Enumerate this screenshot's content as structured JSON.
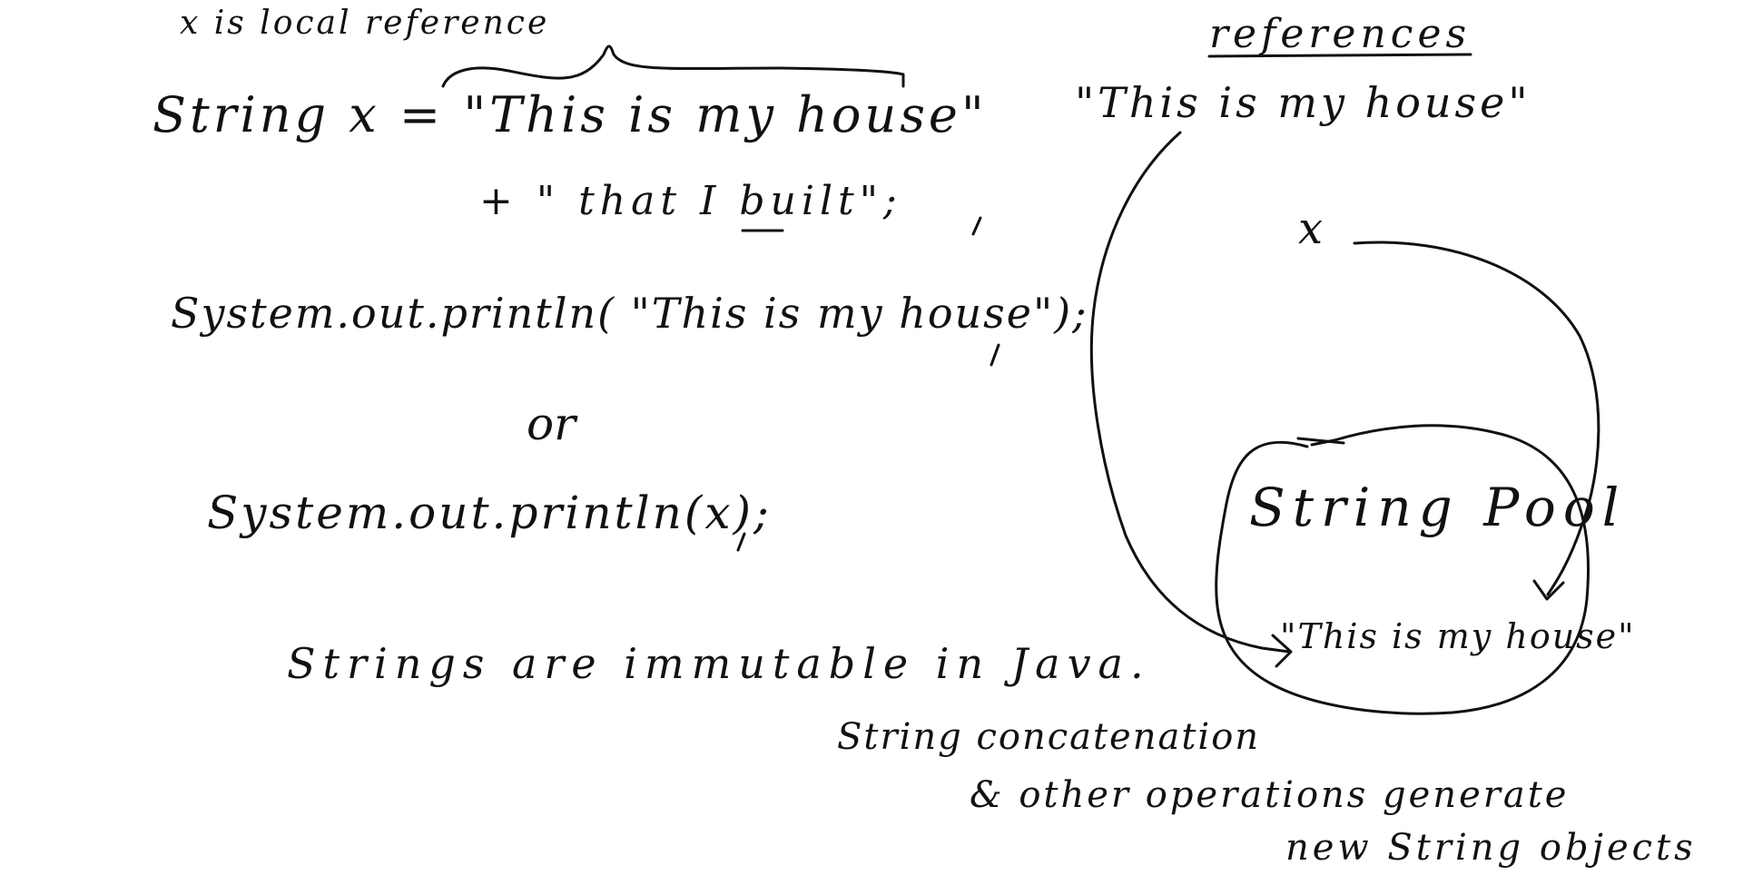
{
  "left": {
    "local_note": "x is local reference",
    "code_line1": "String x = \"This is my house\"",
    "code_line2": "+ \" that I built\";",
    "println_literal": "System.out.println( \"This is my house\");",
    "or": "or",
    "println_var": "System.out.println(x);",
    "immutable": "Strings are immutable in Java.",
    "concat_line1": "String concatenation",
    "concat_line2": "& other operations generate",
    "concat_line3": "new String objects"
  },
  "right": {
    "references_title": "references",
    "ref_literal": "\"This is my house\"",
    "ref_x": "x",
    "pool_title": "String Pool",
    "pool_item": "\"This is my house\""
  },
  "ink_color": "#111111"
}
